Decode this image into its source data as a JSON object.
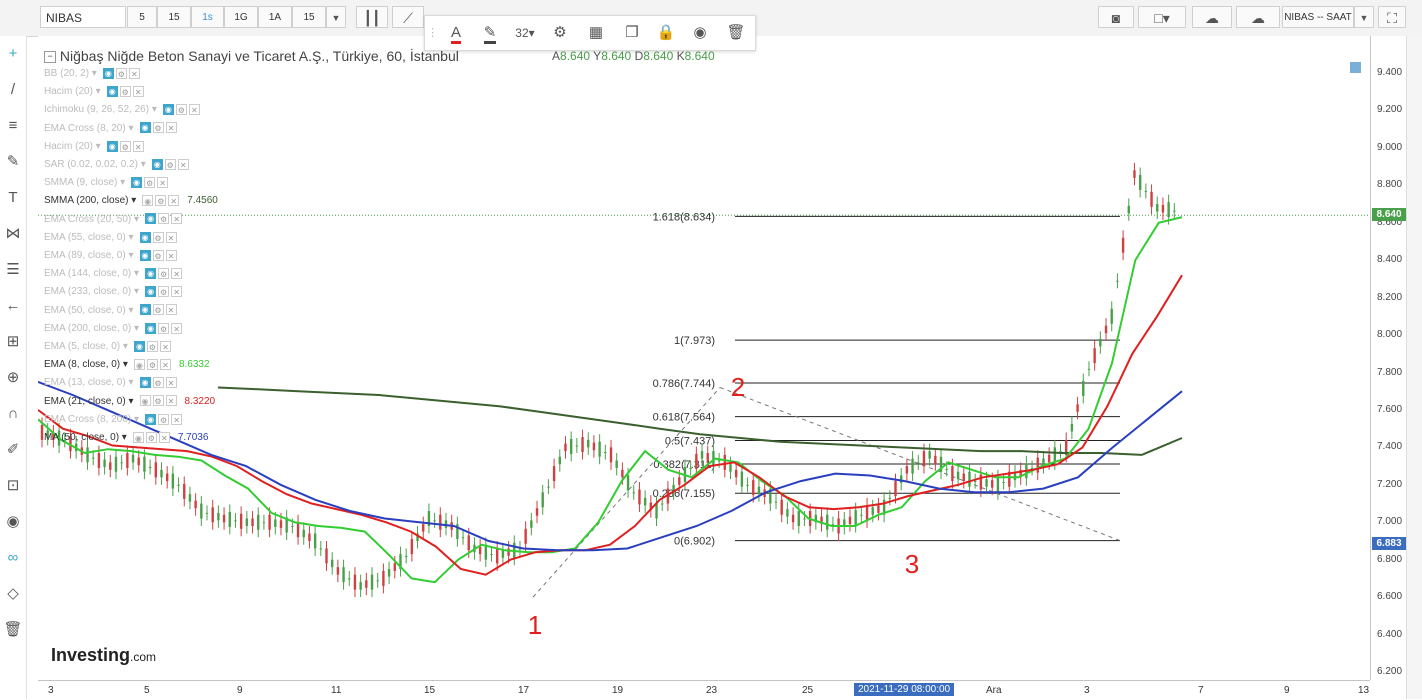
{
  "toolbar": {
    "symbol": "NIBAS",
    "intervals": [
      "5",
      "15",
      "1s",
      "1G",
      "1A",
      "15"
    ],
    "active_interval": "1s",
    "symbol_interval_label": "NIBAS -- SAAT"
  },
  "drawing_toolbar": {
    "font_size": "32"
  },
  "chart_header": {
    "title": "Niğbaş Niğde Beton Sanayi ve Ticaret A.Ş., Türkiye, 60, İstanbul",
    "ohlc": [
      {
        "key": "A",
        "value": "8.640"
      },
      {
        "key": "Y",
        "value": "8.640"
      },
      {
        "key": "D",
        "value": "8.640"
      },
      {
        "key": "K",
        "value": "8.640"
      }
    ]
  },
  "indicators": [
    {
      "name": "BB (20, 2)",
      "enabled": false,
      "value": ""
    },
    {
      "name": "Hacim (20)",
      "enabled": false,
      "value": ""
    },
    {
      "name": "Ichimoku (9, 26, 52, 26)",
      "enabled": false,
      "value": ""
    },
    {
      "name": "EMA Cross (8, 20)",
      "enabled": false,
      "value": ""
    },
    {
      "name": "Hacim (20)",
      "enabled": false,
      "value": ""
    },
    {
      "name": "SAR (0.02, 0.02, 0.2)",
      "enabled": false,
      "value": ""
    },
    {
      "name": "SMMA (9, close)",
      "enabled": false,
      "value": ""
    },
    {
      "name": "SMMA (200, close)",
      "enabled": true,
      "value": "7.4560",
      "color": "#3b5f2e"
    },
    {
      "name": "EMA Cross (20, 50)",
      "enabled": false,
      "value": ""
    },
    {
      "name": "EMA (55, close, 0)",
      "enabled": false,
      "value": ""
    },
    {
      "name": "EMA (89, close, 0)",
      "enabled": false,
      "value": ""
    },
    {
      "name": "EMA (144, close, 0)",
      "enabled": false,
      "value": ""
    },
    {
      "name": "EMA (233, close, 0)",
      "enabled": false,
      "value": ""
    },
    {
      "name": "EMA (50, close, 0)",
      "enabled": false,
      "value": ""
    },
    {
      "name": "EMA (200, close, 0)",
      "enabled": false,
      "value": ""
    },
    {
      "name": "EMA (5, close, 0)",
      "enabled": false,
      "value": ""
    },
    {
      "name": "EMA (8, close, 0)",
      "enabled": true,
      "value": "8.6332",
      "color": "#33cc33"
    },
    {
      "name": "EMA (13, close, 0)",
      "enabled": false,
      "value": ""
    },
    {
      "name": "EMA (21, close, 0)",
      "enabled": true,
      "value": "8.3220",
      "color": "#e02020"
    },
    {
      "name": "EMA Cross (8, 200)",
      "enabled": false,
      "value": ""
    },
    {
      "name": "MA (50, close, 0)",
      "enabled": true,
      "value": "7.7036",
      "color": "#2a3fbf"
    }
  ],
  "chart_data": {
    "type": "line",
    "title": "Niğbaş Niğde Beton Sanayi ve Ticaret A.Ş., Türkiye, 60, İstanbul",
    "xlabel": "",
    "ylabel": "",
    "x_ticks": [
      "3",
      "5",
      "9",
      "11",
      "15",
      "17",
      "19",
      "23",
      "25",
      "2021-11-29 08:00:00",
      "Ara",
      "3",
      "7",
      "9",
      "13"
    ],
    "ylim": [
      6.2,
      9.5
    ],
    "y_ticks": [
      "9.400",
      "9.200",
      "9.000",
      "8.800",
      "8.600",
      "8.400",
      "8.200",
      "8.000",
      "7.800",
      "7.600",
      "7.400",
      "7.200",
      "7.000",
      "6.800",
      "6.600",
      "6.400",
      "6.200"
    ],
    "grid": false,
    "last_price": "8.640",
    "secondary_price": "6.883",
    "price_series": [
      7.48,
      7.44,
      7.36,
      7.3,
      7.34,
      7.28,
      7.2,
      7.06,
      7.02,
      7.0,
      7.0,
      6.98,
      6.9,
      6.74,
      6.66,
      6.7,
      6.82,
      7.02,
      6.98,
      6.86,
      6.82,
      6.86,
      7.12,
      7.4,
      7.42,
      7.36,
      7.16,
      7.06,
      7.22,
      7.36,
      7.32,
      7.2,
      7.14,
      7.02,
      7.02,
      6.98,
      7.04,
      7.08,
      7.28,
      7.36,
      7.26,
      7.22,
      7.2,
      7.26,
      7.32,
      7.4,
      7.82,
      8.1,
      8.86,
      8.68,
      8.66
    ],
    "series": [
      {
        "name": "SMMA (200, close)",
        "color": "#3b5f2e",
        "values": [
          7.72,
          7.71,
          7.7,
          7.69,
          7.68,
          7.66,
          7.64,
          7.62,
          7.59,
          7.56,
          7.53,
          7.5,
          7.47,
          7.45,
          7.43,
          7.42,
          7.41,
          7.4,
          7.39,
          7.38,
          7.38,
          7.37,
          7.37,
          7.36,
          7.45
        ]
      },
      {
        "name": "EMA (8, close, 0)",
        "color": "#33cc33",
        "values": [
          7.55,
          7.44,
          7.37,
          7.39,
          7.38,
          7.36,
          7.35,
          7.33,
          7.25,
          7.18,
          7.05,
          7.0,
          6.98,
          6.97,
          6.95,
          6.83,
          6.7,
          6.68,
          6.8,
          6.88,
          6.85,
          6.84,
          6.84,
          6.86,
          7.0,
          7.22,
          7.38,
          7.28,
          7.24,
          7.34,
          7.32,
          7.22,
          7.14,
          7.02,
          6.98,
          6.98,
          7.04,
          7.08,
          7.22,
          7.32,
          7.28,
          7.24,
          7.24,
          7.3,
          7.34,
          7.5,
          7.85,
          8.4,
          8.6,
          8.63
        ]
      },
      {
        "name": "EMA (21, close, 0)",
        "color": "#e02020",
        "values": [
          7.6,
          7.5,
          7.46,
          7.41,
          7.4,
          7.39,
          7.38,
          7.35,
          7.3,
          7.22,
          7.15,
          7.1,
          7.07,
          7.04,
          7.0,
          6.95,
          6.87,
          6.75,
          6.72,
          6.8,
          6.84,
          6.85,
          6.85,
          6.88,
          6.98,
          7.12,
          7.2,
          7.3,
          7.32,
          7.24,
          7.14,
          7.08,
          7.07,
          7.08,
          7.1,
          7.14,
          7.17,
          7.2,
          7.24,
          7.26,
          7.28,
          7.31,
          7.4,
          7.62,
          7.9,
          8.1,
          8.32
        ]
      },
      {
        "name": "MA (50, close, 0)",
        "color": "#2a3fbf",
        "values": [
          7.75,
          7.68,
          7.6,
          7.52,
          7.44,
          7.36,
          7.3,
          7.2,
          7.12,
          7.06,
          7.02,
          7.0,
          6.98,
          6.9,
          6.86,
          6.85,
          6.85,
          6.86,
          6.92,
          6.98,
          7.06,
          7.16,
          7.22,
          7.26,
          7.25,
          7.22,
          7.18,
          7.16,
          7.16,
          7.18,
          7.24,
          7.4,
          7.55,
          7.7
        ]
      }
    ],
    "fibonacci": [
      {
        "label": "1.618(8.634)",
        "level": 1.618,
        "value": 8.634
      },
      {
        "label": "1(7.973)",
        "level": 1,
        "value": 7.973
      },
      {
        "label": "0.786(7.744)",
        "level": 0.786,
        "value": 7.744
      },
      {
        "label": "0.618(7.564)",
        "level": 0.618,
        "value": 7.564
      },
      {
        "label": "0.5(7.437)",
        "level": 0.5,
        "value": 7.437
      },
      {
        "label": "0.382(7.311)",
        "level": 0.382,
        "value": 7.311
      },
      {
        "label": "0.236(7.155)",
        "level": 0.236,
        "value": 7.155
      },
      {
        "label": "0(6.902)",
        "level": 0,
        "value": 6.902
      }
    ],
    "wave_labels": [
      {
        "text": "1",
        "price": 6.6
      },
      {
        "text": "2",
        "price": 7.74
      },
      {
        "text": "3",
        "price": 6.9
      }
    ]
  },
  "branding": {
    "logo_main": "Investing",
    "logo_suffix": ".com"
  },
  "colors": {
    "accent": "#3ea6cc",
    "up": "#4aa04a",
    "down": "#e02020",
    "fib_line": "#222222",
    "last_price_bg": "#4aa04a",
    "cursor_price_bg": "#3a6cbf"
  }
}
